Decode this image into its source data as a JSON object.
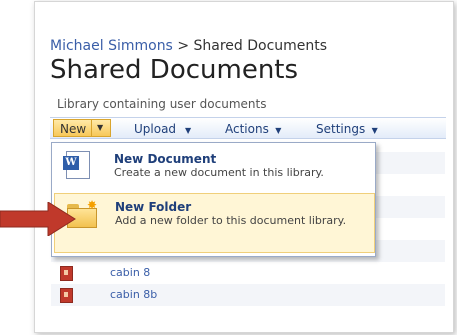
{
  "breadcrumb": {
    "site": "Michael Simmons",
    "separator": ">",
    "current": "Shared Documents"
  },
  "page": {
    "title": "Shared Documents",
    "description": "Library containing user documents"
  },
  "toolbar": {
    "new_label": "New",
    "upload_label": "Upload",
    "actions_label": "Actions",
    "settings_label": "Settings"
  },
  "new_menu": {
    "items": [
      {
        "title": "New Document",
        "description": "Create a new document in this library.",
        "icon": "word-document-icon"
      },
      {
        "title": "New Folder",
        "description": "Add a new folder to this document library.",
        "icon": "new-folder-icon"
      }
    ]
  },
  "files": [
    {
      "name": "cabin 8",
      "icon": "image-file-icon"
    },
    {
      "name": "cabin 8b",
      "icon": "image-file-icon"
    }
  ],
  "colors": {
    "link": "#3a5ea8",
    "menu_highlight": "#fff6d6",
    "arrow": "#c0392b"
  }
}
